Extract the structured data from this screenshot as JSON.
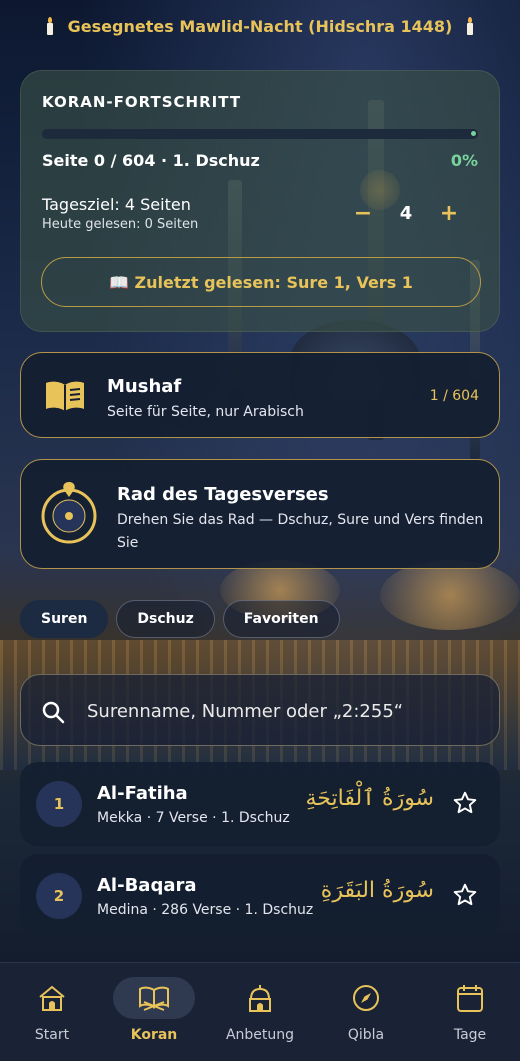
{
  "banner": {
    "text": "Gesegnetes Mawlid-Nacht (Hidschra 1448)"
  },
  "progress": {
    "title": "KORAN-FORTSCHRITT",
    "page_text": "Seite 0 / 604 · 1. Dschuz",
    "percent_text": "0%",
    "percent_value": 0,
    "goal_text": "Tagesziel: 4 Seiten",
    "today_text": "Heute gelesen: 0 Seiten",
    "stepper": {
      "minus": "−",
      "value": "4",
      "plus": "+"
    },
    "last_read": {
      "icon": "open-book",
      "label": "📖 Zuletzt gelesen: Sure 1, Vers 1"
    }
  },
  "mushaf": {
    "title": "Mushaf",
    "subtitle": "Seite für Seite, nur Arabisch",
    "pages": "1 / 604"
  },
  "rad": {
    "title": "Rad des Tagesverses",
    "subtitle": "Drehen Sie das Rad — Dschuz, Sure und Vers finden Sie"
  },
  "tabs": [
    {
      "label": "Suren",
      "active": true
    },
    {
      "label": "Dschuz",
      "active": false
    },
    {
      "label": "Favoriten",
      "active": false
    }
  ],
  "search": {
    "placeholder": "Surenname, Nummer oder „2:255“"
  },
  "suras": [
    {
      "number": "1",
      "name": "Al-Fatiha",
      "meta": "Mekka · 7 Verse · 1. Dschuz",
      "arabic": "سُورَةُ ٱلْفَاتِحَةِ"
    },
    {
      "number": "2",
      "name": "Al-Baqara",
      "meta": "Medina · 286 Verse · 1. Dschuz",
      "arabic": "سُورَةُ البَقَرَةِ"
    }
  ],
  "nav": [
    {
      "label": "Start",
      "icon": "home-icon",
      "active": false
    },
    {
      "label": "Koran",
      "icon": "quran-icon",
      "active": true
    },
    {
      "label": "Anbetung",
      "icon": "mosque-icon",
      "active": false
    },
    {
      "label": "Qibla",
      "icon": "compass-icon",
      "active": false
    },
    {
      "label": "Tage",
      "icon": "calendar-icon",
      "active": false
    }
  ],
  "colors": {
    "gold": "#e8c35a",
    "green": "#79d39c",
    "card_dark": "#141e30",
    "nav_bg": "#1a2236"
  }
}
